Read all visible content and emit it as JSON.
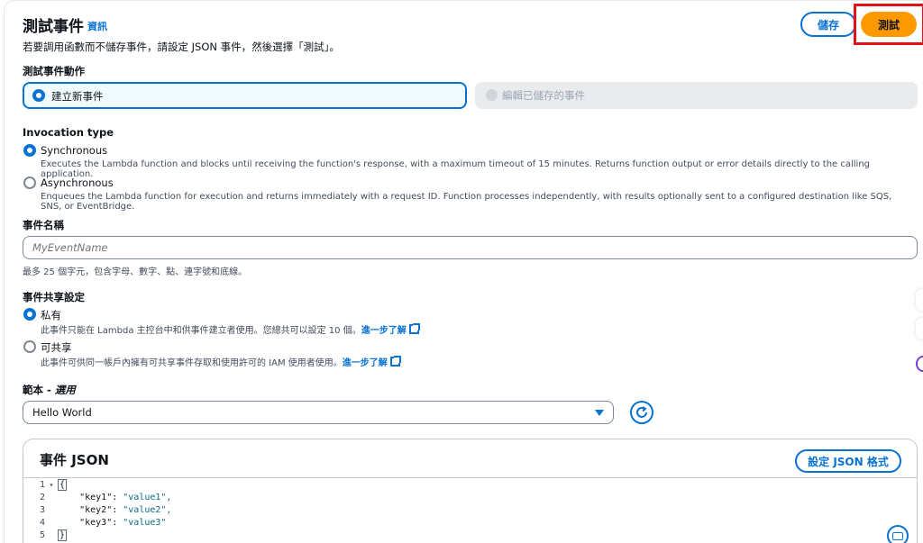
{
  "header": {
    "title": "測試事件",
    "info_link": "資訊",
    "subtitle": "若要調用函數而不儲存事件，請設定 JSON 事件，然後選擇「測試」。",
    "save_label": "儲存",
    "test_label": "測試"
  },
  "test_action": {
    "label": "測試事件動作",
    "option_new": "建立新事件",
    "option_edit": "編輯已儲存的事件"
  },
  "invocation": {
    "label": "Invocation type",
    "sync_label": "Synchronous",
    "sync_desc": "Executes the Lambda function and blocks until receiving the function's response, with a maximum timeout of 15 minutes. Returns function output or error details directly to the calling application.",
    "async_label": "Asynchronous",
    "async_desc": "Enqueues the Lambda function for execution and returns immediately with a request ID. Function processes independently, with results optionally sent to a configured destination like SQS, SNS, or EventBridge."
  },
  "event_name": {
    "label": "事件名稱",
    "placeholder": "MyEventName",
    "hint": "最多 25 個字元，包含字母、數字、點、連字號和底線。"
  },
  "sharing": {
    "label": "事件共享設定",
    "private_label": "私有",
    "private_desc": "此事件只能在 Lambda 主控台中和供事件建立者使用。您總共可以設定 10 個。",
    "shareable_label": "可共享",
    "shareable_desc": "此事件可供同一帳戶內擁有可共享事件存取和使用許可的 IAM 使用者使用。",
    "learn_more": "進一步了解"
  },
  "template": {
    "label": "範本 - ",
    "label_optional": "選用",
    "selected": "Hello World"
  },
  "event_json": {
    "title": "事件 JSON",
    "format_button": "設定 JSON 格式",
    "lines": [
      {
        "num": "1",
        "fold": "▾",
        "text": "{"
      },
      {
        "num": "2",
        "fold": "",
        "key": "\"key1\"",
        "value": "\"value1\","
      },
      {
        "num": "3",
        "fold": "",
        "key": "\"key2\"",
        "value": "\"value2\","
      },
      {
        "num": "4",
        "fold": "",
        "key": "\"key3\"",
        "value": "\"value3\""
      },
      {
        "num": "5",
        "fold": "",
        "text": "}"
      }
    ]
  },
  "colors": {
    "accent": "#0972d3",
    "primary_button": "#ff9900",
    "highlight_box": "#e3111b"
  }
}
